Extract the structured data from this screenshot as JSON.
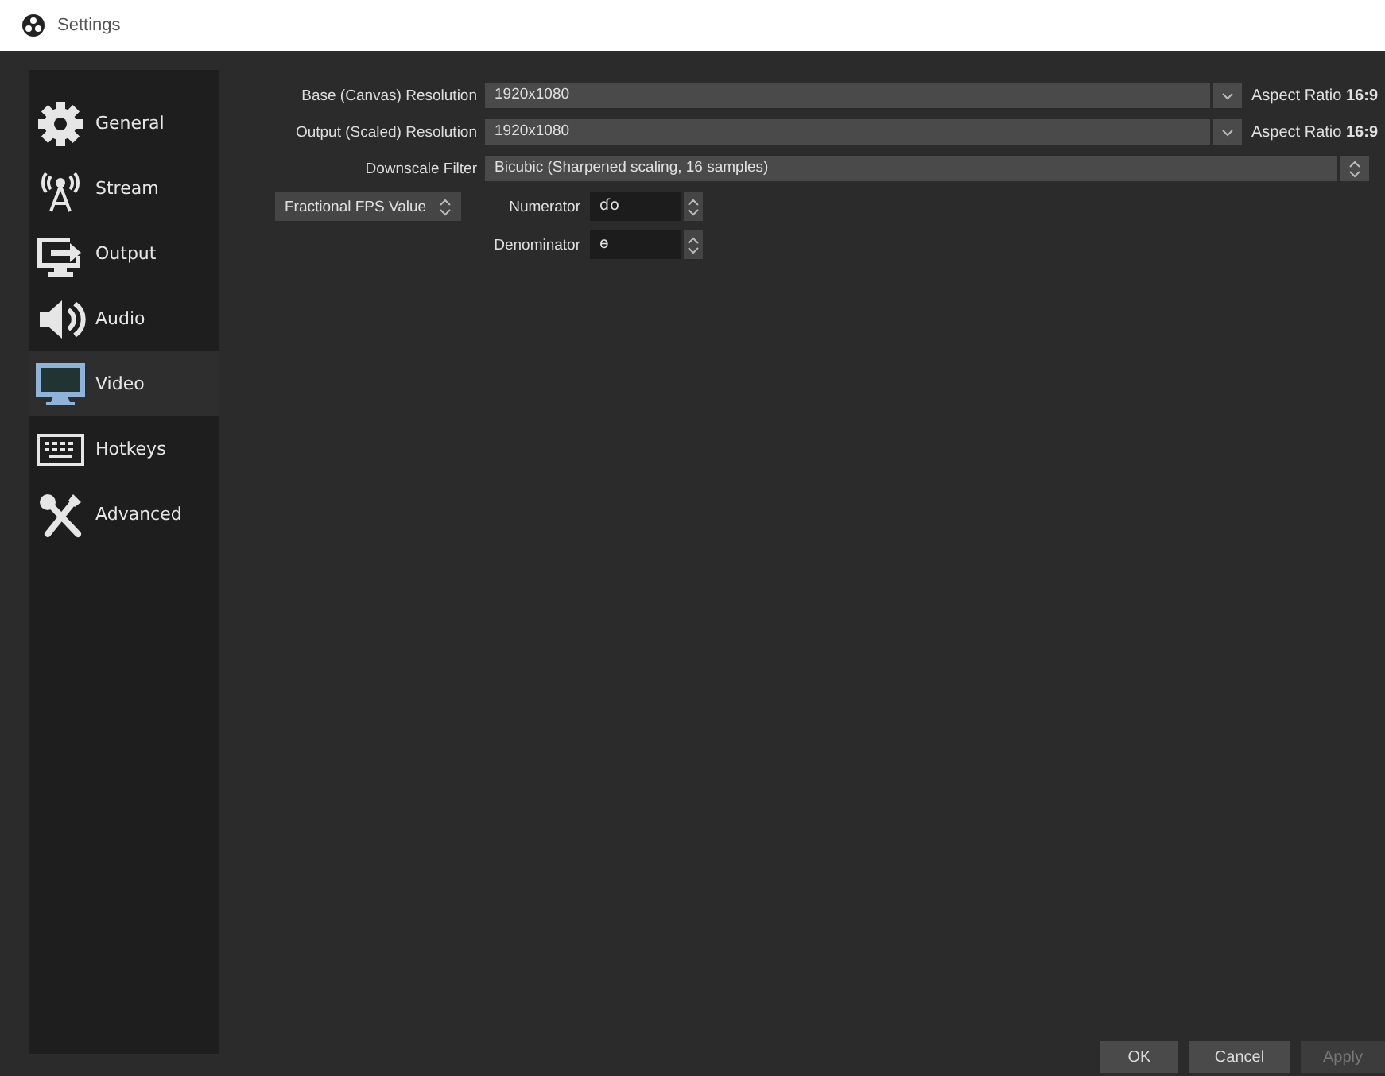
{
  "window": {
    "title": "Settings"
  },
  "sidebar": {
    "items": [
      {
        "label": "General",
        "selected": false
      },
      {
        "label": "Stream",
        "selected": false
      },
      {
        "label": "Output",
        "selected": false
      },
      {
        "label": "Audio",
        "selected": false
      },
      {
        "label": "Video",
        "selected": true
      },
      {
        "label": "Hotkeys",
        "selected": false
      },
      {
        "label": "Advanced",
        "selected": false
      }
    ]
  },
  "video": {
    "base_resolution": {
      "label": "Base (Canvas) Resolution",
      "value": "1920x1080",
      "aspect_label": "Aspect Ratio ",
      "aspect_value": "16:9"
    },
    "output_resolution": {
      "label": "Output (Scaled) Resolution",
      "value": "1920x1080",
      "aspect_label": "Aspect Ratio ",
      "aspect_value": "16:9"
    },
    "downscale_filter": {
      "label": "Downscale Filter",
      "value": "Bicubic (Sharpened scaling, 16 samples)"
    },
    "fps_type": {
      "value": "Fractional FPS Value"
    },
    "numerator": {
      "label": "Numerator",
      "value": "ɗo"
    },
    "denominator": {
      "label": "Denominator",
      "value": "ɵ"
    }
  },
  "buttons": [
    {
      "label": "OK",
      "disabled": false
    },
    {
      "label": "Cancel",
      "disabled": false
    },
    {
      "label": "Apply",
      "disabled": true
    }
  ]
}
